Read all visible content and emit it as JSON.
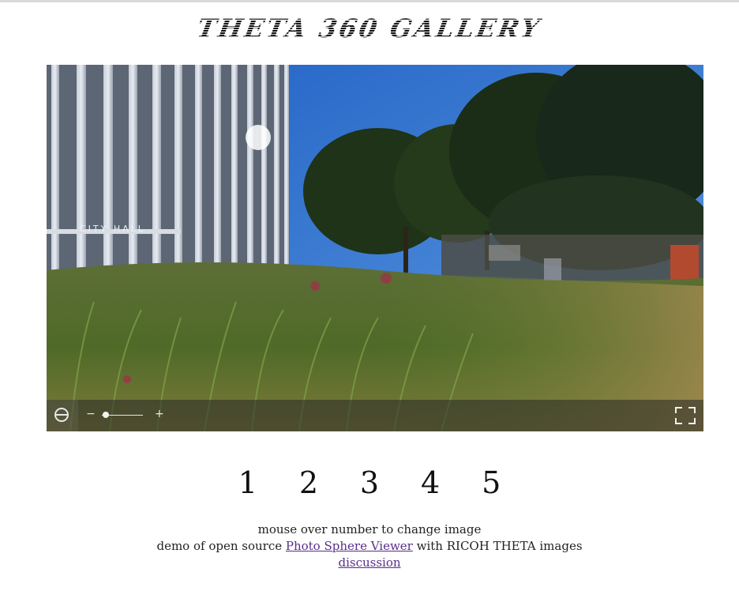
{
  "page": {
    "title": "THETA 360 GALLERY"
  },
  "viewer": {
    "sign_text": "CITY HALL",
    "zoom_level": 0.1,
    "icons": {
      "autorotate": "globe-icon",
      "fullscreen": "fullscreen-icon"
    },
    "zoom_minus": "−",
    "zoom_plus": "+"
  },
  "selector": {
    "numbers": [
      "1",
      "2",
      "3",
      "4",
      "5"
    ]
  },
  "footer": {
    "line1": "mouse over number to change image",
    "line2_prefix": "demo of open source ",
    "line2_link": "Photo Sphere Viewer",
    "line2_suffix": " with RICOH THETA images",
    "discussion_link": "discussion"
  },
  "colors": {
    "link": "#5a2d8c",
    "sky": "#3b7bc8"
  }
}
